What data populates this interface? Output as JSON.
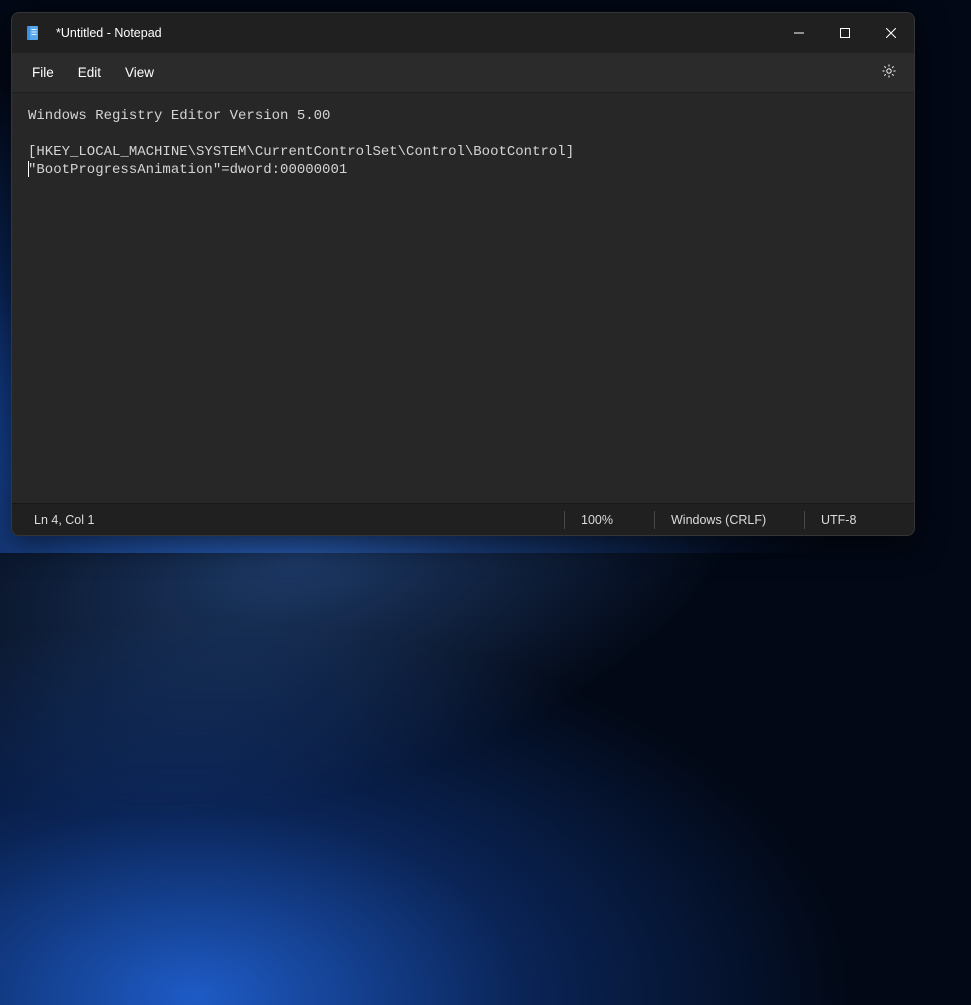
{
  "window": {
    "title": "*Untitled - Notepad"
  },
  "menu": {
    "file": "File",
    "edit": "Edit",
    "view": "View"
  },
  "editor": {
    "content": "Windows Registry Editor Version 5.00\n\n[HKEY_LOCAL_MACHINE\\SYSTEM\\CurrentControlSet\\Control\\BootControl]\n\"BootProgressAnimation\"=dword:00000001"
  },
  "status": {
    "position": "Ln 4, Col 1",
    "zoom": "100%",
    "line_ending": "Windows (CRLF)",
    "encoding": "UTF-8"
  }
}
